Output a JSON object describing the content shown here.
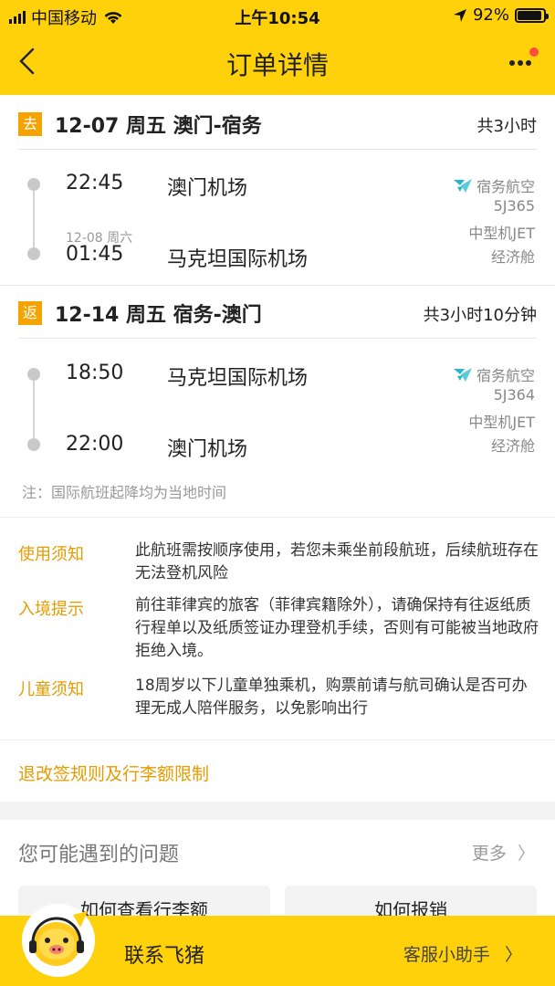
{
  "status_bar": {
    "carrier": "中国移动",
    "time": "上午10:54",
    "battery": "92%",
    "battery_level": 0.92
  },
  "nav": {
    "title": "订单详情"
  },
  "outbound": {
    "tag": "去",
    "title": "12-07 周五 澳门-宿务",
    "duration": "共3小时",
    "depart_time": "22:45",
    "depart_airport": "澳门机场",
    "arrive_date": "12-08 周六",
    "arrive_time": "01:45",
    "arrive_airport": "马克坦国际机场",
    "airline": "宿务航空",
    "flight_no": "5J365",
    "aircraft": "中型机JET",
    "cabin": "经济舱"
  },
  "return": {
    "tag": "返",
    "title": "12-14 周五 宿务-澳门",
    "duration": "共3小时10分钟",
    "depart_time": "18:50",
    "depart_airport": "马克坦国际机场",
    "arrive_time": "22:00",
    "arrive_airport": "澳门机场",
    "airline": "宿务航空",
    "flight_no": "5J364",
    "aircraft": "中型机JET",
    "cabin": "经济舱"
  },
  "note": "注：国际航班起降均为当地时间",
  "rules": [
    {
      "label": "使用须知",
      "text": "此航班需按顺序使用，若您未乘坐前段航班，后续航班存在无法登机风险"
    },
    {
      "label": "入境提示",
      "text": "前往菲律宾的旅客（菲律宾籍除外），请确保持有往返纸质行程单以及纸质签证办理登机手续，否则有可能被当地政府拒绝入境。"
    },
    {
      "label": "儿童须知",
      "text": "18周岁以下儿童单独乘机，购票前请与航司确认是否可办理无成人陪伴服务，以免影响出行"
    }
  ],
  "refund_link": "退改签规则及行李额限制",
  "faq": {
    "title": "您可能遇到的问题",
    "more": "更多",
    "items": [
      "如何查看行李额",
      "如何报销"
    ]
  },
  "bottom_bar": {
    "contact": "联系飞猪",
    "assistant": "客服小助手"
  },
  "colors": {
    "brand_yellow": "#ffd10a",
    "accent_orange": "#f5a300",
    "link_orange": "#e69b00",
    "airline_teal": "#2bb5c9"
  }
}
